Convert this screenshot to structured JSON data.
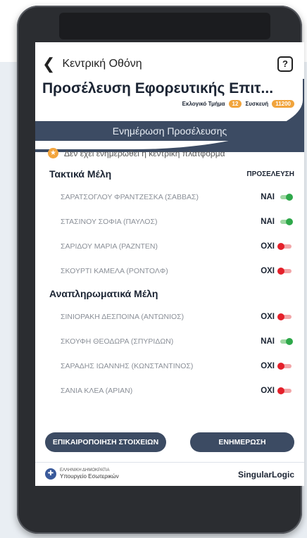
{
  "header": {
    "back_label": "Κεντρική Οθόνη",
    "title": "Προσέλευση Εφορευτικής Επιτ...",
    "section_label": "Εκλογικό Τμήμα",
    "section_badge": "12",
    "device_label": "Συσκευή",
    "device_badge": "11200",
    "subheader": "Ενημέρωση Προσέλευσης"
  },
  "warning": {
    "text": "Δεν έχει ενημερωθεί η κεντρική πλατφόρμα"
  },
  "groups": [
    {
      "title": "Τακτικά Μέλη",
      "column_header": "ΠΡΟΣΕΛΕΥΣΗ",
      "members": [
        {
          "name": "ΣΑΡΑΤΣΟΓΛΟΥ ΦΡΑΝΤΖΕΣΚΑ (ΣΑΒΒΑΣ)",
          "attendance": "ΝΑΙ",
          "on": true
        },
        {
          "name": "ΣΤΑΣΙΝΟΥ ΣΟΦΙΑ (ΠΑΥΛΟΣ)",
          "attendance": "ΝΑΙ",
          "on": true
        },
        {
          "name": "ΣΑΡΙΔΟΥ ΜΑΡΙΑ (ΡΑΖΝΤΕΝ)",
          "attendance": "ΟΧΙ",
          "on": false
        },
        {
          "name": "ΣΚΟΥΡΤΙ ΚΑΜΕΛΑ (ΡΟΝΤΟΛΦ)",
          "attendance": "ΟΧΙ",
          "on": false
        }
      ]
    },
    {
      "title": "Αναπληρωματικά Μέλη",
      "column_header": "",
      "members": [
        {
          "name": "ΣΙΝΙΟΡΑΚΗ ΔΕΣΠΟΙΝΑ (ΑΝΤΩΝΙΟΣ)",
          "attendance": "ΟΧΙ",
          "on": false
        },
        {
          "name": "ΣΚΟΥΦΗ ΘΕΟΔΩΡΑ (ΣΠΥΡΙΔΩΝ)",
          "attendance": "ΝΑΙ",
          "on": true
        },
        {
          "name": "ΣΑΡΑΔΗΣ ΙΩΑΝΝΗΣ (ΚΩΝΣΤΑΝΤΙΝΟΣ)",
          "attendance": "ΟΧΙ",
          "on": false
        },
        {
          "name": "ΣΑΝΙΑ ΚΛΕΑ (ΑΡΙΑΝ)",
          "attendance": "ΟΧΙ",
          "on": false
        }
      ]
    }
  ],
  "buttons": {
    "refresh_label": "ΕΠΙΚΑΙΡΟΠΟΙΗΣΗ ΣΤΟΙΧΕΙΩΝ",
    "update_label": "ΕΝΗΜΕΡΩΣΗ"
  },
  "footer": {
    "ministry_line1": "ΕΛΛΗΝΙΚΗ ΔΗΜΟΚΡΑΤΙΑ",
    "ministry_line2": "Υπουργείο Εσωτερικών",
    "vendor": "SingularLogic"
  },
  "colors": {
    "primary": "#3c4b63",
    "accent": "#f1a43c",
    "on": "#2ea84a",
    "off": "#e4202a"
  },
  "icons": {
    "back": "chevron-left-icon",
    "help": "help-icon",
    "warning": "star-warning-icon"
  }
}
